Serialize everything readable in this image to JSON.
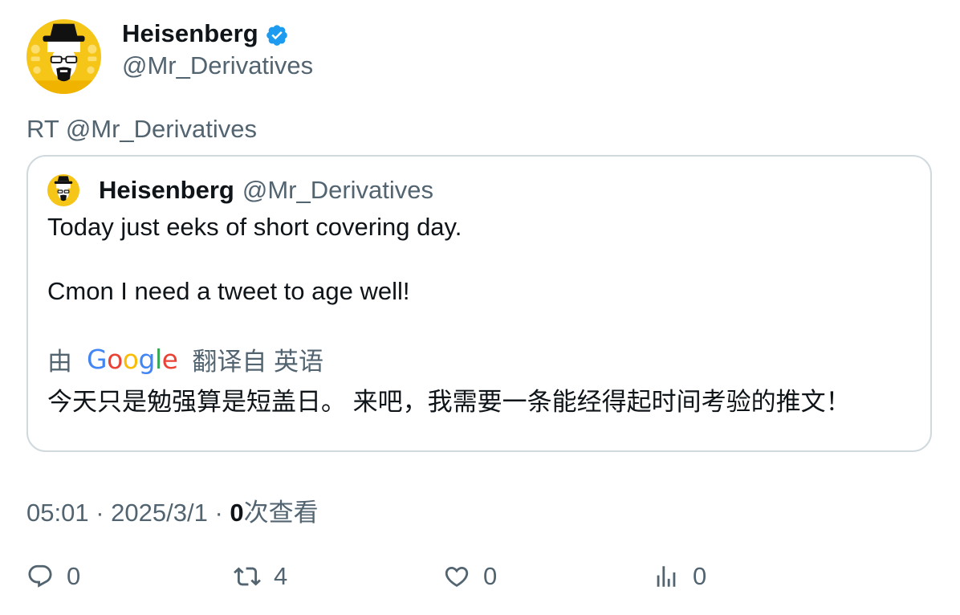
{
  "author": {
    "display_name": "Heisenberg",
    "handle": "@Mr_Derivatives",
    "verified": true,
    "avatar_colors": {
      "background": "#f5c518",
      "face": "#ffffff"
    }
  },
  "retweet_label": "RT @Mr_Derivatives",
  "quoted_tweet": {
    "display_name": "Heisenberg",
    "handle": "@Mr_Derivatives",
    "text_line_1": "Today just eeks of short covering day.",
    "text_line_2": "Cmon I need a tweet to age well!",
    "translation": {
      "prefix": "由",
      "provider_logo_letters": [
        "G",
        "o",
        "o",
        "g",
        "l",
        "e"
      ],
      "suffix": "翻译自 英语",
      "translated_text": "今天只是勉强算是短盖日。 来吧，我需要一条能经得起时间考验的推文！"
    }
  },
  "meta": {
    "time": "05:01",
    "separator": "·",
    "date": "2025/3/1",
    "views_count": "0",
    "views_label": "次查看"
  },
  "actions": {
    "reply": {
      "icon": "reply-icon",
      "count": "0"
    },
    "retweet": {
      "icon": "retweet-icon",
      "count": "4"
    },
    "like": {
      "icon": "heart-icon",
      "count": "0"
    },
    "views": {
      "icon": "analytics-icon",
      "count": "0"
    }
  },
  "colors": {
    "primary_text": "#0f1419",
    "secondary_text": "#536471",
    "border": "#cfd9de",
    "verified": "#1d9bf0"
  }
}
